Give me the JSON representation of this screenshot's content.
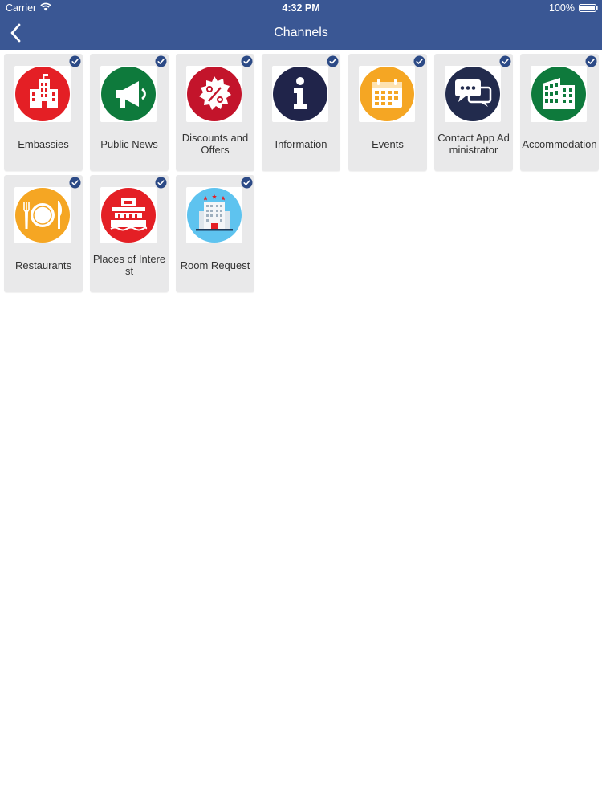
{
  "status_bar": {
    "carrier": "Carrier",
    "time": "4:32 PM",
    "battery": "100%"
  },
  "nav": {
    "title": "Channels"
  },
  "colors": {
    "header": "#3a5794",
    "tile_bg": "#e9e9ea",
    "check": "#2c4a86",
    "embassies": "#e41f25",
    "public_news": "#0e7a3c",
    "discounts": "#c3142b",
    "information": "#20244a",
    "events": "#f5a623",
    "contact": "#222b4d",
    "accommodation": "#0e7a3c",
    "restaurants": "#f5a623",
    "places": "#e41f25",
    "room_request": "#5ec3ef"
  },
  "channels": [
    {
      "label": "Embassies",
      "icon": "embassy-building-icon",
      "selected": true
    },
    {
      "label": "Public News",
      "icon": "megaphone-icon",
      "selected": true
    },
    {
      "label": "Discounts and Offers",
      "icon": "percent-badge-icon",
      "selected": true
    },
    {
      "label": "Information",
      "icon": "info-icon",
      "selected": true
    },
    {
      "label": "Events",
      "icon": "calendar-icon",
      "selected": true
    },
    {
      "label": "Contact App Administrator",
      "icon": "chat-bubbles-icon",
      "selected": true
    },
    {
      "label": "Accommodation",
      "icon": "office-building-icon",
      "selected": true
    },
    {
      "label": "Restaurants",
      "icon": "plate-cutlery-icon",
      "selected": true
    },
    {
      "label": "Places of Interest",
      "icon": "landmark-icon",
      "selected": true
    },
    {
      "label": "Room Request",
      "icon": "hotel-icon",
      "selected": true
    }
  ]
}
